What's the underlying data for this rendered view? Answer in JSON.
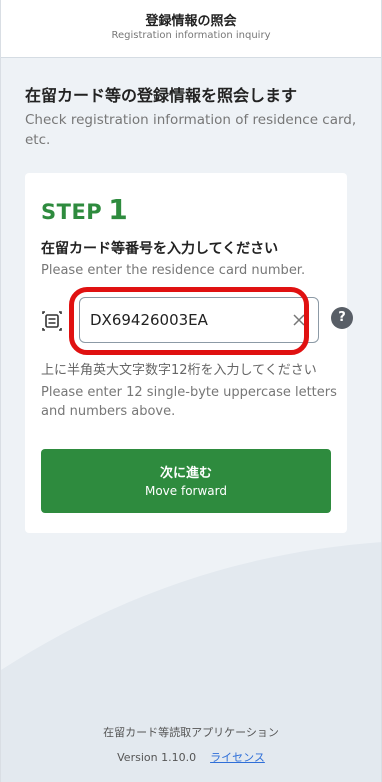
{
  "header": {
    "title": "登録情報の照会",
    "subtitle": "Registration information inquiry"
  },
  "main": {
    "title": "在留カード等の登録情報を照会します",
    "subtitle": "Check registration information of residence card, etc."
  },
  "step": {
    "label": "STEP",
    "number": "1",
    "instruction": "在留カード等番号を入力してください",
    "instruction_en": "Please enter the residence card number.",
    "card_number": {
      "value": "DX69426003EA",
      "placeholder": ""
    },
    "help_icon": "?",
    "hint": "上に半角英大文字数字12桁を入力してください",
    "hint_en": "Please enter 12 single-byte uppercase letters and numbers above."
  },
  "next_button": {
    "label": "次に進む",
    "sublabel": "Move forward"
  },
  "footer": {
    "app_name": "在留カード等読取アプリケーション",
    "version": "Version 1.10.0",
    "license_link": "ライセンス"
  },
  "icons": {
    "card": "card-icon",
    "clear": "close-icon",
    "help": "help-icon"
  },
  "colors": {
    "accent_green": "#2e8b3e",
    "highlight_red": "#e01111",
    "link_blue": "#2f6fd8",
    "background": "#eef2f6"
  }
}
